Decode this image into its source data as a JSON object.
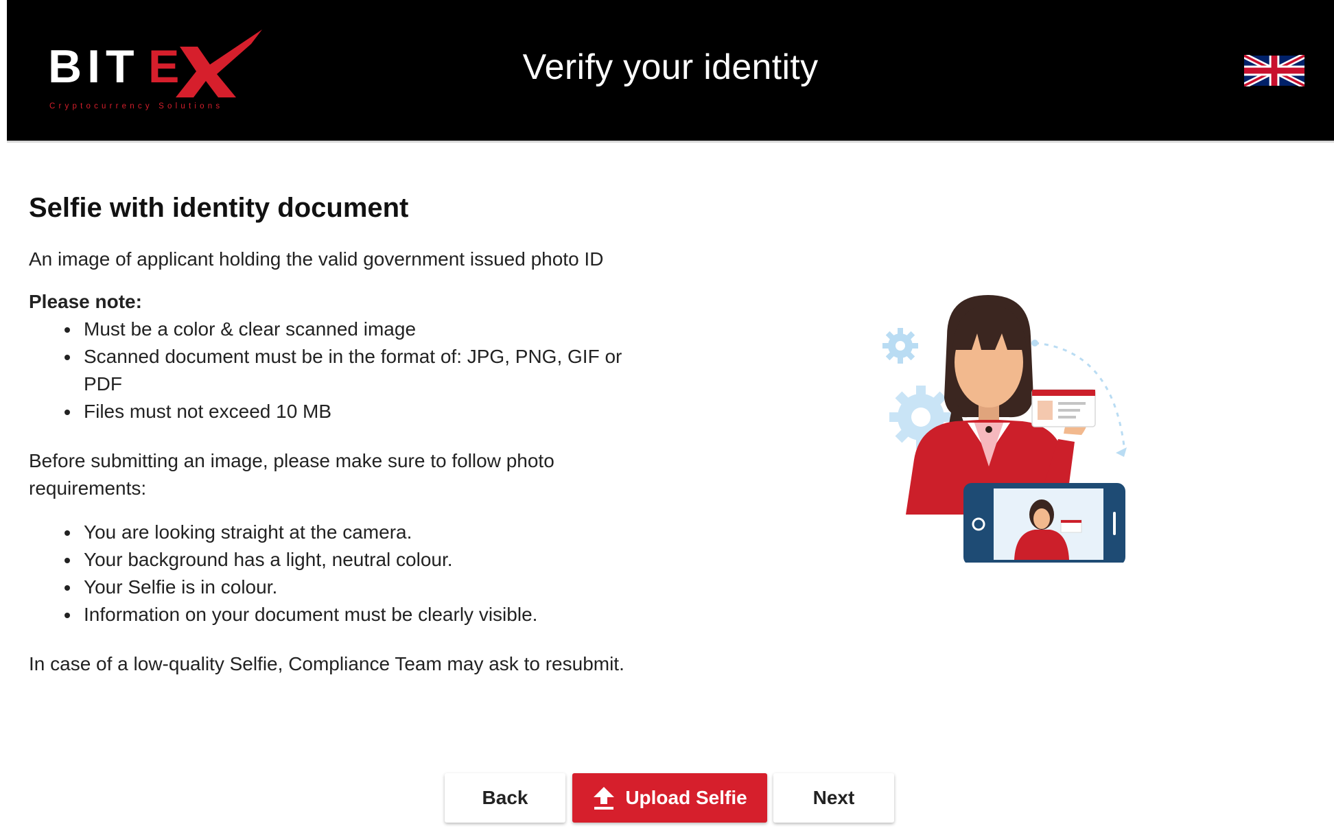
{
  "header": {
    "logo_text": "BITEX",
    "logo_tagline": "Cryptocurrency Solutions",
    "title": "Verify your identity",
    "language_icon": "uk-flag-icon"
  },
  "main": {
    "section_title": "Selfie with identity document",
    "intro": "An image of applicant holding the valid government issued photo ID",
    "note_label": "Please note:",
    "notes": [
      "Must be a color & clear scanned image",
      "Scanned document must be in the format of: JPG, PNG, GIF or PDF",
      "Files must not exceed 10 MB"
    ],
    "before_text": "Before submitting an image, please make sure to follow photo requirements:",
    "requirements": [
      "You are looking straight at the camera.",
      "Your background has a light, neutral colour.",
      "Your Selfie is in colour.",
      "Information on your document must be clearly visible."
    ],
    "final_text": "In case of a low-quality Selfie, Compliance Team may ask to resubmit."
  },
  "actions": {
    "back_label": "Back",
    "upload_label": "Upload Selfie",
    "upload_icon": "upload-arrow-icon",
    "next_label": "Next"
  },
  "colors": {
    "header_bg": "#000000",
    "accent": "#d61f2c",
    "text": "#222222"
  }
}
